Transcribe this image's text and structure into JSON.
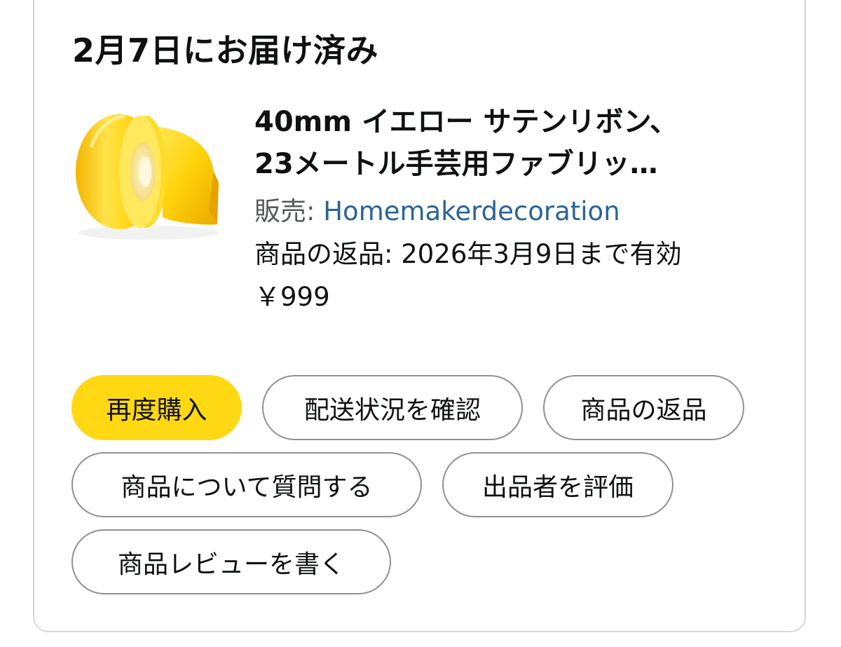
{
  "delivery": {
    "title": "2月7日にお届け済み"
  },
  "product": {
    "image_icon": "yellow-ribbon-spool-image",
    "title_line1": "40mm イエロー サテンリボン、",
    "title_line2": "23メートル手芸用ファブリッ…",
    "seller_label": "販売: ",
    "seller_name": "Homemakerdecoration",
    "return_text": "商品の返品: 2026年3月9日まで有効",
    "price": "￥999"
  },
  "actions": {
    "buy_again": "再度購入",
    "track_package": "配送状況を確認",
    "return_item": "商品の返品",
    "ask_question": "商品について質問する",
    "rate_seller": "出品者を評価",
    "write_review": "商品レビューを書く"
  },
  "colors": {
    "primary_button": "#ffd814",
    "link": "#2a6496",
    "border": "#8d9096",
    "ribbon": "#ffd200"
  }
}
